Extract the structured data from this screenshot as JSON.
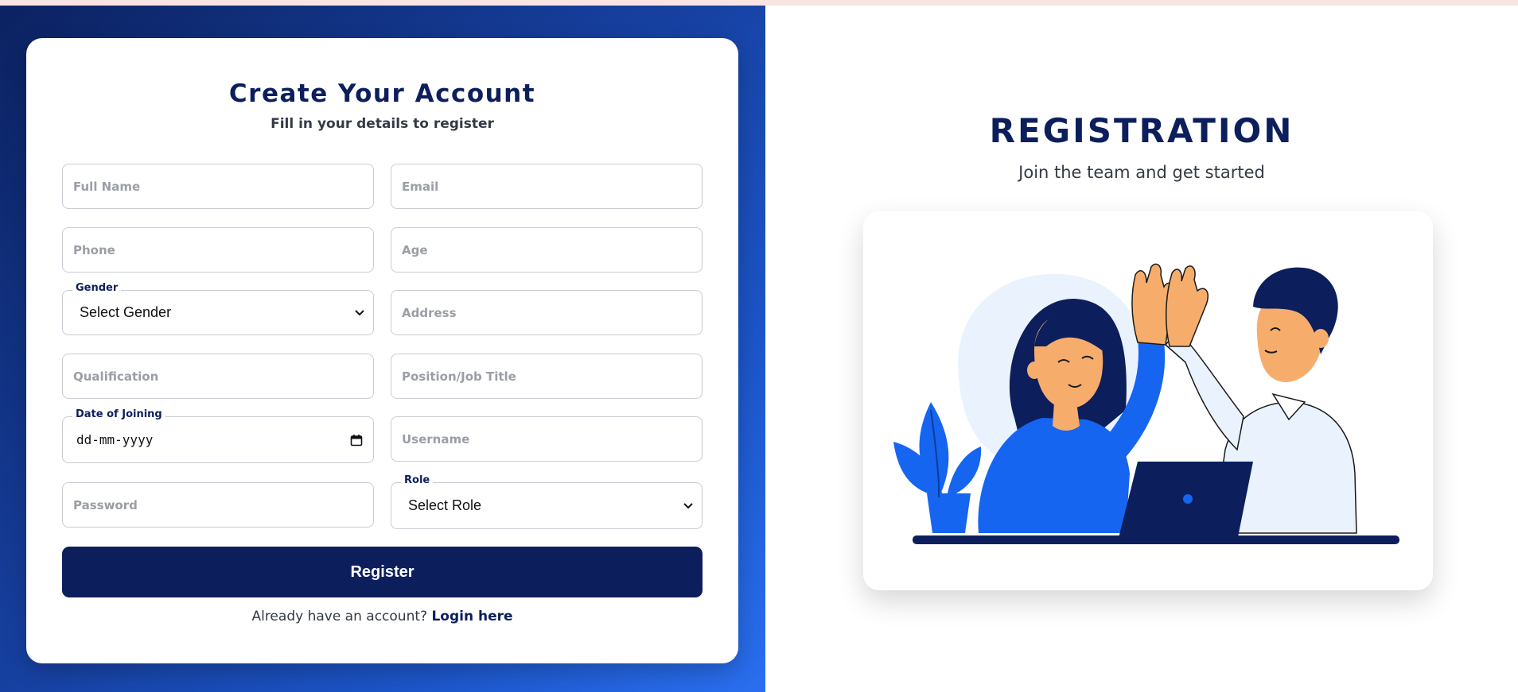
{
  "form": {
    "title": "Create Your Account",
    "subtitle": "Fill in your details to register",
    "full_name": {
      "placeholder": "Full Name"
    },
    "email": {
      "placeholder": "Email"
    },
    "phone": {
      "placeholder": "Phone"
    },
    "age": {
      "placeholder": "Age"
    },
    "gender": {
      "label": "Gender",
      "selected": "Select Gender"
    },
    "address": {
      "placeholder": "Address"
    },
    "qualification": {
      "placeholder": "Qualification"
    },
    "position": {
      "placeholder": "Position/Job Title"
    },
    "date_of_joining": {
      "label": "Date of Joining",
      "value": "dd-mm-yyyy"
    },
    "username": {
      "placeholder": "Username"
    },
    "password": {
      "placeholder": "Password"
    },
    "role": {
      "label": "Role",
      "selected": "Select Role"
    },
    "register_label": "Register",
    "login_prompt": "Already have an account?",
    "login_link": "Login here"
  },
  "hero": {
    "title": "REGISTRATION",
    "subtitle": "Join the team and get started",
    "illustration": "high-five-illustration"
  },
  "colors": {
    "brand_navy": "#0c1f5c",
    "accent_blue": "#1565f0",
    "gradient_start": "#0c2261",
    "gradient_end": "#2a6ff0"
  },
  "icons": [
    "chevron-down-icon",
    "calendar-icon"
  ]
}
